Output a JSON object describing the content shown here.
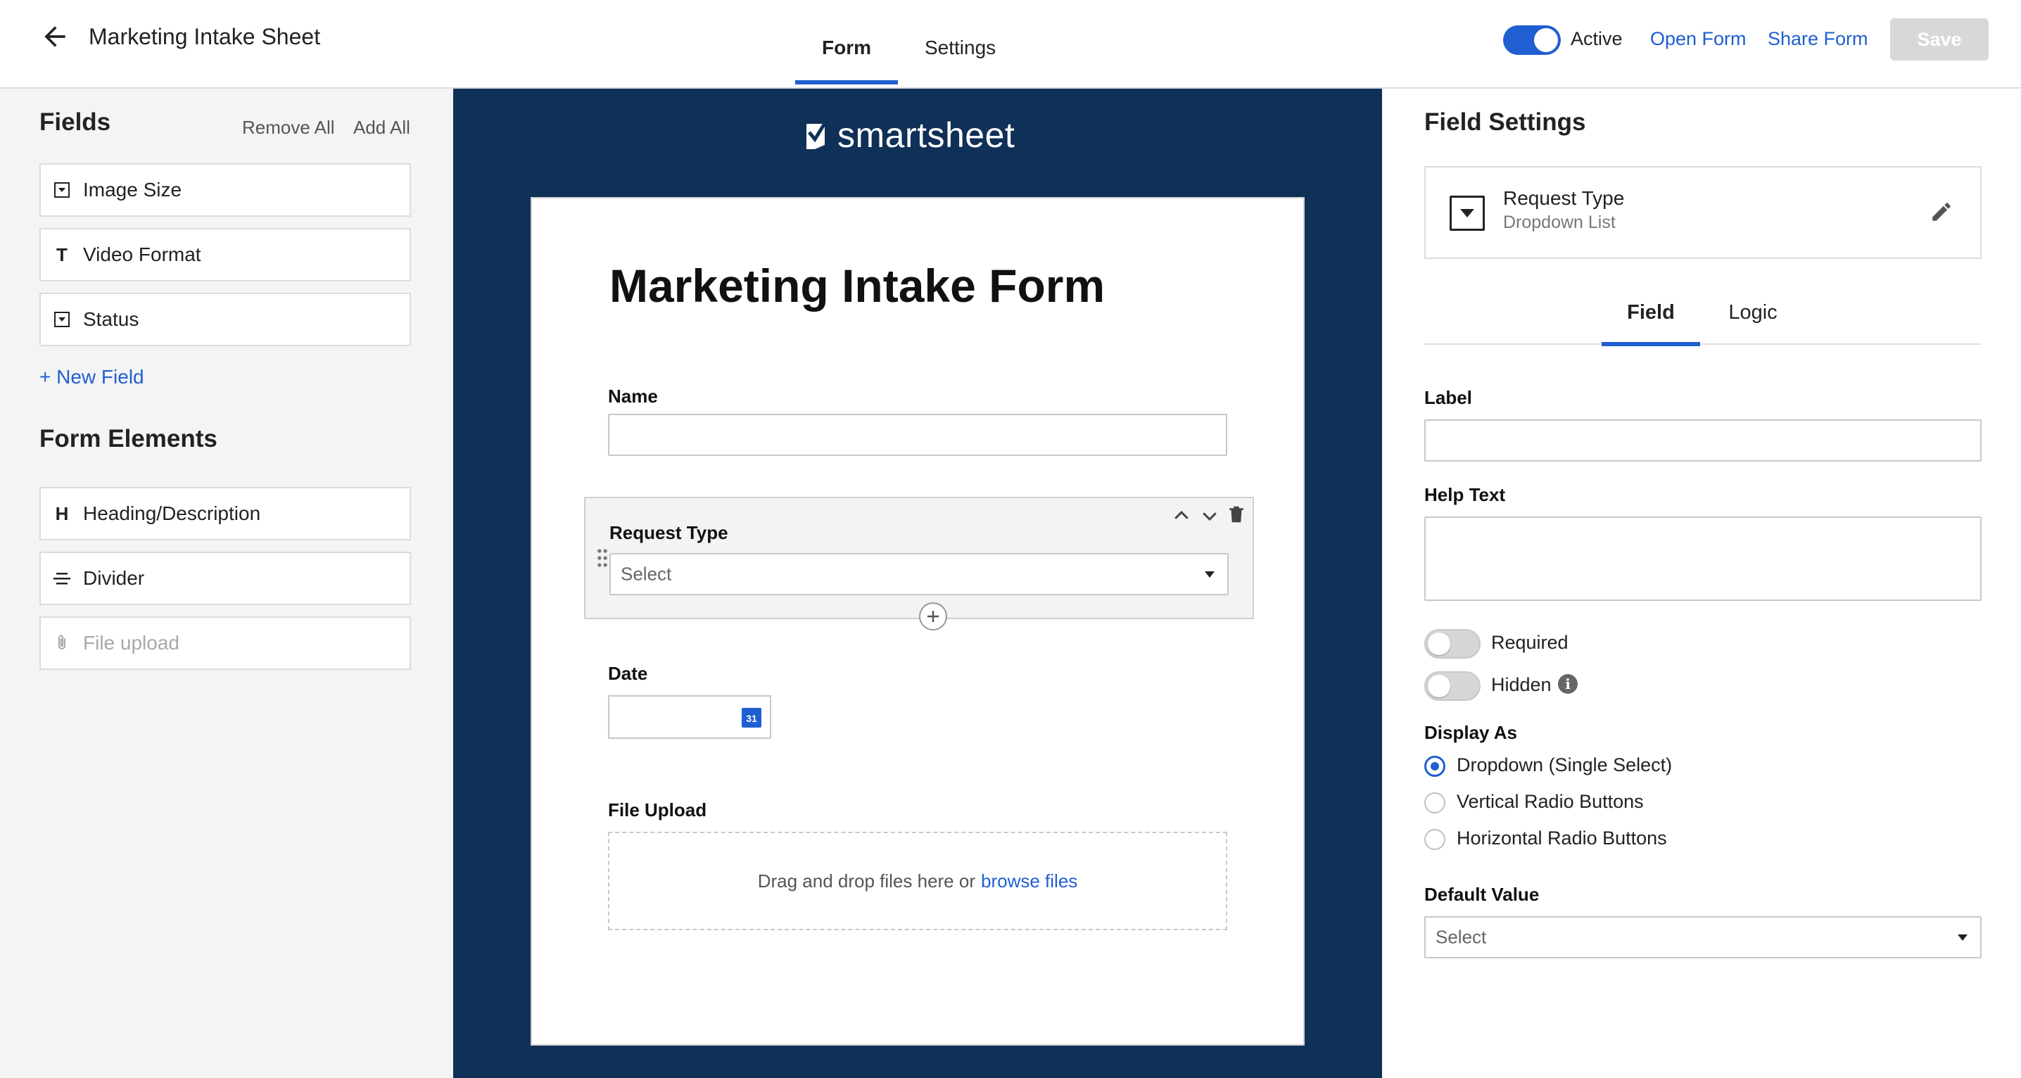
{
  "header": {
    "sheet_title": "Marketing Intake Sheet",
    "tabs": [
      {
        "label": "Form",
        "active": true
      },
      {
        "label": "Settings",
        "active": false
      }
    ],
    "active_label": "Active",
    "active_on": true,
    "open_form": "Open Form",
    "share_form": "Share Form",
    "save": "Save"
  },
  "left": {
    "fields_title": "Fields",
    "remove_all": "Remove All",
    "add_all": "Add All",
    "fields": [
      {
        "label": "Image Size",
        "icon": "dropdown-icon"
      },
      {
        "label": "Video Format",
        "icon": "text-icon",
        "glyph": "T"
      },
      {
        "label": "Status",
        "icon": "dropdown-icon"
      }
    ],
    "new_field": "+ New Field",
    "elements_title": "Form Elements",
    "elements": [
      {
        "label": "Heading/Description",
        "icon": "heading-icon",
        "glyph": "H"
      },
      {
        "label": "Divider",
        "icon": "divider-icon"
      },
      {
        "label": "File upload",
        "icon": "paperclip-icon",
        "disabled": true
      }
    ]
  },
  "center": {
    "logo_text": "smartsheet",
    "form_title": "Marketing Intake Form",
    "name_label": "Name",
    "request_type_label": "Request Type",
    "request_type_placeholder": "Select",
    "date_label": "Date",
    "date_icon_text": "31",
    "file_upload_label": "File Upload",
    "drop_text": "Drag and drop files here or",
    "browse_text": "browse files"
  },
  "right": {
    "title": "Field Settings",
    "field_name": "Request Type",
    "field_type": "Dropdown List",
    "tabs": [
      {
        "label": "Field",
        "active": true
      },
      {
        "label": "Logic",
        "active": false
      }
    ],
    "label_label": "Label",
    "help_text_label": "Help Text",
    "required_label": "Required",
    "required_on": false,
    "hidden_label": "Hidden",
    "hidden_on": false,
    "display_as_label": "Display As",
    "display_options": [
      {
        "label": "Dropdown (Single Select)",
        "checked": true
      },
      {
        "label": "Vertical Radio Buttons",
        "checked": false
      },
      {
        "label": "Horizontal Radio Buttons",
        "checked": false
      }
    ],
    "default_value_label": "Default Value",
    "default_value_placeholder": "Select"
  },
  "colors": {
    "accent": "#1f5fd1",
    "center_background": "#0f3057",
    "left_background": "#f4f4f4",
    "save_disabled": "#d8d8d8"
  }
}
